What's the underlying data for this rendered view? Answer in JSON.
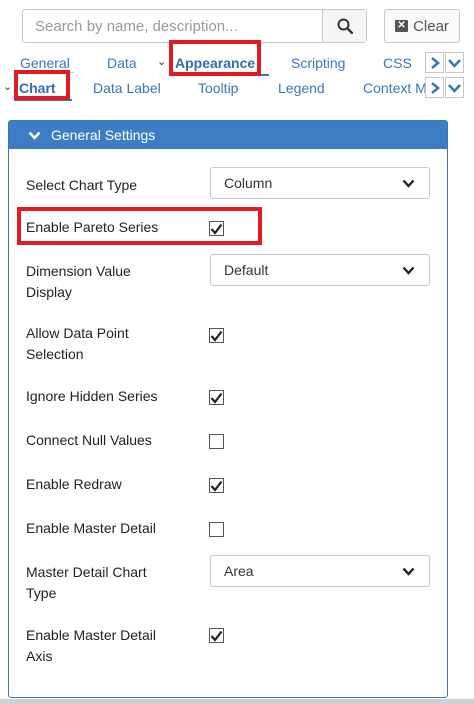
{
  "search": {
    "placeholder": "Search by name, description..."
  },
  "toolbar": {
    "clear_label": "Clear"
  },
  "tabs": {
    "general": "General",
    "data": "Data",
    "appearance": "Appearance",
    "scripting": "Scripting",
    "css": "CSS"
  },
  "subtabs": {
    "chart": "Chart",
    "data_label": "Data Label",
    "tooltip": "Tooltip",
    "legend": "Legend",
    "context_menu": "Context M"
  },
  "panel": {
    "title": "General Settings"
  },
  "settings": {
    "chart_type": {
      "label": "Select Chart Type",
      "value": "Column"
    },
    "pareto": {
      "label": "Enable Pareto Series",
      "checked": true
    },
    "dimension_display": {
      "label_line1": "Dimension Value",
      "label_line2": "Display",
      "value": "Default"
    },
    "allow_selection": {
      "label_line1": "Allow Data Point",
      "label_line2": "Selection",
      "checked": true
    },
    "ignore_hidden": {
      "label": "Ignore Hidden Series",
      "checked": true
    },
    "connect_nulls": {
      "label": "Connect Null Values",
      "checked": false
    },
    "redraw": {
      "label": "Enable Redraw",
      "checked": true
    },
    "master_detail": {
      "label": "Enable Master Detail",
      "checked": false
    },
    "master_detail_type": {
      "label_line1": "Master Detail Chart",
      "label_line2": "Type",
      "value": "Area"
    },
    "master_detail_axis": {
      "label_line1": "Enable Master Detail",
      "label_line2": "Axis",
      "checked": true
    }
  },
  "colors": {
    "accent": "#3c7dc4",
    "highlight": "#e21b23",
    "link": "#3878b8"
  }
}
